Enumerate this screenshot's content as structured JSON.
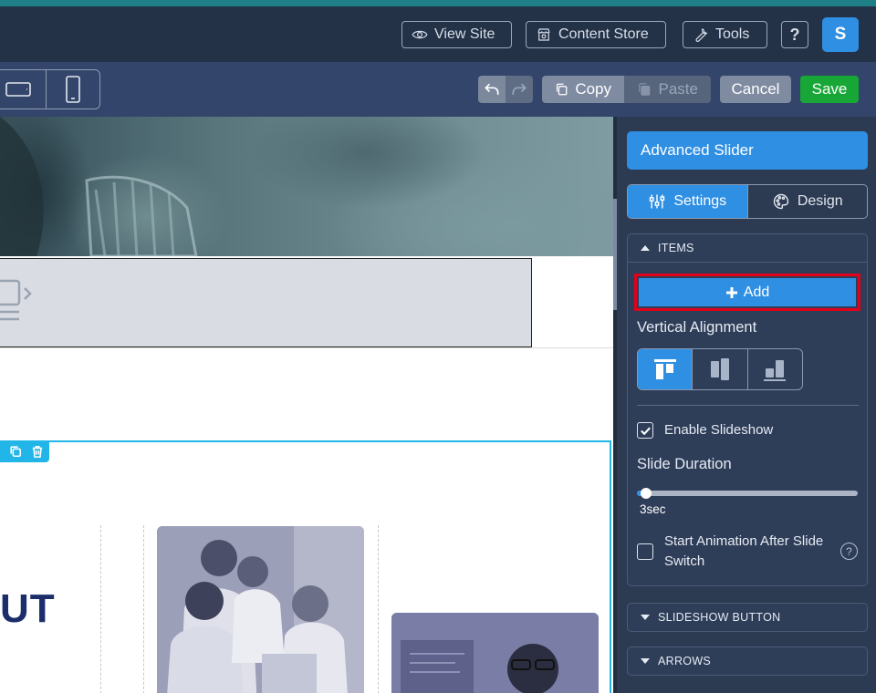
{
  "topbar": {
    "view_site": "View Site",
    "content_store": "Content Store",
    "tools": "Tools",
    "help": "?",
    "avatar_initial": "S"
  },
  "toolbar": {
    "copy": "Copy",
    "paste": "Paste",
    "cancel": "Cancel",
    "save": "Save"
  },
  "canvas": {
    "heading_fragment": "UT"
  },
  "panel": {
    "title": "Advanced Slider",
    "tabs": [
      {
        "label": "Settings",
        "active": true
      },
      {
        "label": "Design",
        "active": false
      }
    ],
    "items_section": {
      "header": "ITEMS",
      "add_label": "Add",
      "vertical_alignment_label": "Vertical Alignment",
      "vertical_alignment_selected": "top",
      "enable_slideshow_label": "Enable Slideshow",
      "enable_slideshow_checked": true,
      "slide_duration_label": "Slide Duration",
      "slide_duration_value": "3sec",
      "start_animation_label": "Start Animation After Slide Switch",
      "start_animation_checked": false
    },
    "collapsed_sections": [
      "SLIDESHOW BUTTON",
      "ARROWS"
    ]
  },
  "colors": {
    "accent": "#2f8fe3",
    "save": "#18a736",
    "highlight": "#e3001b",
    "selection": "#22b6e8"
  }
}
